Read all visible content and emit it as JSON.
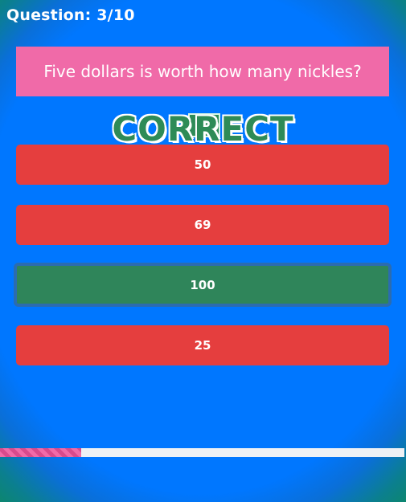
{
  "header": {
    "question_counter": "Question: 3/10"
  },
  "question": {
    "text": "Five dollars is worth how many nickles?"
  },
  "feedback": {
    "text": "CORRECT"
  },
  "answers": [
    {
      "label": "50",
      "state": "wrong"
    },
    {
      "label": "69",
      "state": "wrong"
    },
    {
      "label": "100",
      "state": "correct"
    },
    {
      "label": "25",
      "state": "wrong"
    }
  ],
  "progress": {
    "fraction": 0.2
  },
  "colors": {
    "background": "#0077ff",
    "question_box": "#f06aa8",
    "wrong_answer": "#e53e3e",
    "correct_answer": "#2f855a",
    "feedback_text": "#2e8b57",
    "progress_fill": "#f06aa8",
    "progress_track": "#eef1f5"
  }
}
